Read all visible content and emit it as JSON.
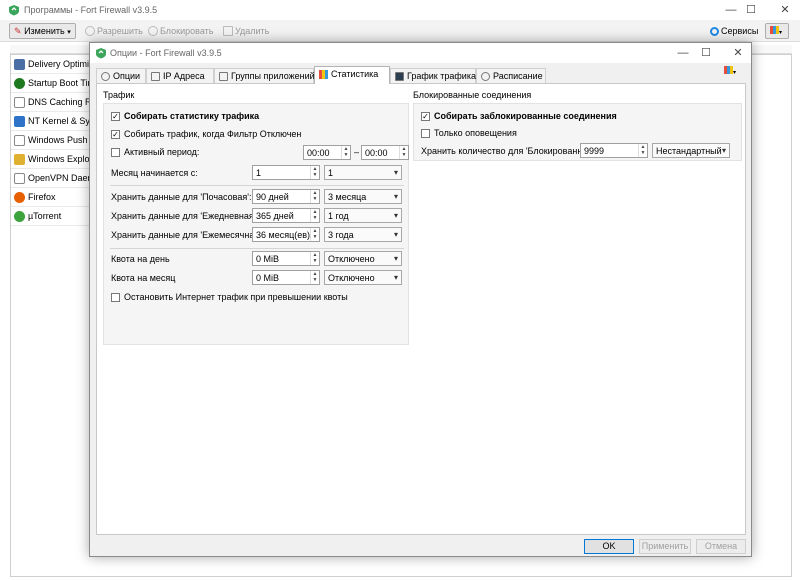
{
  "main": {
    "title": "Программы - Fort Firewall v3.9.5",
    "toolbar": {
      "edit": "Изменить",
      "allow": "Разрешить",
      "block": "Блокировать",
      "remove": "Удалить",
      "services": "Сервисы"
    },
    "apps": [
      {
        "name": "Delivery Optimizat",
        "color": "#4a6fa5"
      },
      {
        "name": "Startup Boot Time",
        "color": "#1f7a1f"
      },
      {
        "name": "DNS Caching Reso",
        "color": "#6a6a6a"
      },
      {
        "name": "NT Kernel & Syste",
        "color": "#2e73c8"
      },
      {
        "name": "Windows Push No",
        "color": "#6a6a6a"
      },
      {
        "name": "Windows Explorer",
        "color": "#e0b030"
      },
      {
        "name": "OpenVPN Daemor",
        "color": "#6a6a6a"
      },
      {
        "name": "Firefox",
        "color": "#e66000"
      },
      {
        "name": "µTorrent",
        "color": "#3da33d"
      }
    ]
  },
  "dialog": {
    "title": "Опции - Fort Firewall v3.9.5",
    "tabs": [
      "Опции",
      "IP Адреса",
      "Группы приложений",
      "Статистика",
      "График трафика",
      "Расписание"
    ],
    "traffic": {
      "title": "Трафик",
      "collect_stats": "Собирать статистику трафика",
      "collect_when_filter_off": "Собирать трафик, когда Фильтр Отключен",
      "active_period": "Активный период:",
      "period_from": "00:00",
      "period_dash": "–",
      "period_to": "00:00",
      "month_start_label": "Месяц начинается с:",
      "month_start_value": "1",
      "month_start_combo": "1",
      "hourly_label": "Хранить данные для 'Почасовая':",
      "hourly_value": "90 дней",
      "hourly_combo": "3 месяца",
      "daily_label": "Хранить данные для 'Ежедневная':",
      "daily_value": "365 дней",
      "daily_combo": "1 год",
      "monthly_label": "Хранить данные для 'Ежемесячная':",
      "monthly_value": "36 месяц(ев)",
      "monthly_combo": "3 года",
      "quota_day_label": "Квота на день",
      "quota_day_value": "0 MiB",
      "quota_day_combo": "Отключено",
      "quota_month_label": "Квота на месяц",
      "quota_month_value": "0 MiB",
      "quota_month_combo": "Отключено",
      "stop_on_quota": "Остановить Интернет трафик при превышении квоты"
    },
    "blocked": {
      "title": "Блокированные соединения",
      "collect_blocked": "Собирать заблокированные соединения",
      "only_notifications": "Только оповещения",
      "keep_count_label": "Хранить количество для 'Блокированные",
      "keep_count_value": "9999",
      "keep_count_combo": "Нестандартный"
    },
    "buttons": {
      "ok": "OK",
      "apply": "Применить",
      "cancel": "Отмена"
    }
  }
}
